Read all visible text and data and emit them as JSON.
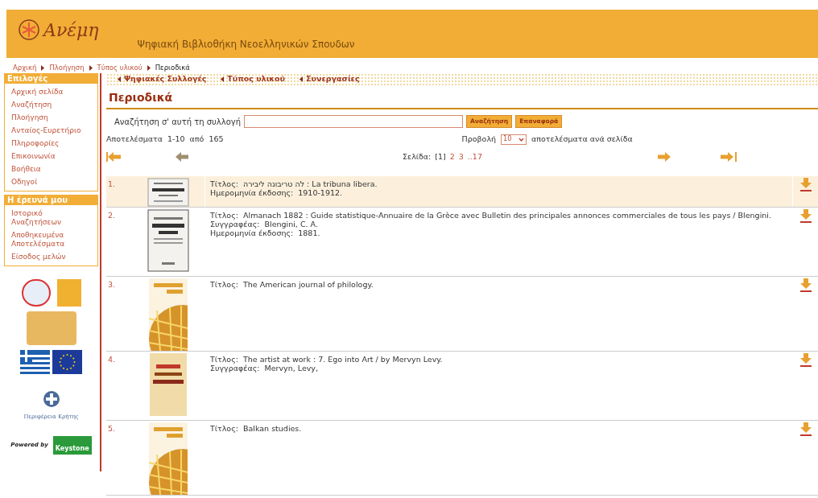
{
  "header": {
    "logo_text": "Ανέμη",
    "subtitle": "Ψηφιακή Βιβλιοθήκη Νεοελληνικών Σπουδων"
  },
  "breadcrumb": [
    {
      "label": "Αρχική",
      "current": false
    },
    {
      "label": "Πλοήγηση",
      "current": false
    },
    {
      "label": "Τύπος υλικού",
      "current": false
    },
    {
      "label": "Περιοδικά",
      "current": true
    }
  ],
  "sidebar": {
    "sections": [
      {
        "title": "Επιλογές",
        "items": [
          "Αρχική σελίδα",
          "Αναζήτηση",
          "Πλοήγηση",
          "Ανταίος-Ευρετήριο",
          "Πληροφορίες",
          "Επικοινωνία",
          "Βοήθεια",
          "Οδηγοί"
        ]
      },
      {
        "title": "Η έρευνά μου",
        "items": [
          "Ιστορικό Αναζητήσεων",
          "Αποθηκευμένα Αποτελέσματα",
          "Είσοδος μελών"
        ]
      }
    ],
    "region_caption": "Περιφέρεια Κρήτης",
    "powered_by": "Powered by",
    "powered_logo": "Keystone"
  },
  "subnav": [
    "Ψηφιακές Συλλογές",
    "Τύπος υλικού",
    "Συνεργασίες"
  ],
  "page_title": "Περιοδικά",
  "search": {
    "label": "Αναζήτηση σ' αυτή τη συλλογή",
    "buttons": [
      "Αναζήτηση",
      "Επαναφορά"
    ]
  },
  "results_summary": {
    "label": "Αποτελέσματα",
    "range": "1-10",
    "of": "από",
    "total": "165"
  },
  "per_page": {
    "label": "Προβολή",
    "value": "10",
    "suffix": "αποτελέσματα ανά σελίδα"
  },
  "pager": {
    "label": "Σελίδα:",
    "pages": [
      {
        "label": "[1]",
        "selected": true
      },
      {
        "label": "2",
        "selected": false
      },
      {
        "label": "3",
        "selected": false
      },
      {
        "label": "..17",
        "selected": false
      }
    ]
  },
  "results": [
    {
      "number": "1.",
      "highlighted": true,
      "kind": "strip",
      "fields": [
        {
          "label": "Τίτλος:",
          "value": "לה טריבונה ליבירה : La tribuna libera."
        },
        {
          "label": "Ημερομηνία έκδοσης:",
          "value": "1910-1912."
        }
      ]
    },
    {
      "number": "2.",
      "highlighted": false,
      "kind": "scan",
      "fields": [
        {
          "label": "Τίτλος:",
          "value": "Almanach 1882 : Guide statistique-Annuaire de la Grèce avec Bulletin des principales annonces commerciales de tous les pays / Blengini."
        },
        {
          "label": "Συγγραφέας:",
          "value": "Blengini, C. A."
        },
        {
          "label": "Ημερομηνία έκδοσης:",
          "value": "1881."
        }
      ]
    },
    {
      "number": "3.",
      "highlighted": false,
      "kind": "external",
      "fields": [
        {
          "label": "Τίτλος:",
          "value": "The American journal of philology."
        }
      ]
    },
    {
      "number": "4.",
      "highlighted": false,
      "kind": "none",
      "fields": [
        {
          "label": "Τίτλος:",
          "value": "The artist at work : 7. Ego into Art / by Mervyn Levy."
        },
        {
          "label": "Συγγραφέας:",
          "value": "Mervyn, Levy,"
        }
      ]
    },
    {
      "number": "5.",
      "highlighted": false,
      "kind": "external",
      "fields": [
        {
          "label": "Τίτλος:",
          "value": "Balkan studies."
        }
      ]
    }
  ]
}
